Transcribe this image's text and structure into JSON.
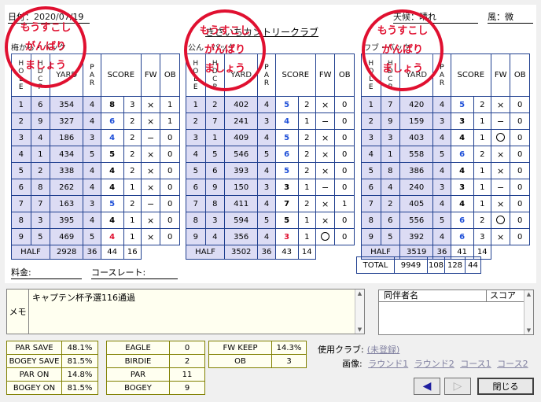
{
  "header": {
    "date": "日付：2020/07/19",
    "weather": "天候：晴れ",
    "wind": "風：微",
    "course_name": "きさいちカントリークラブ",
    "partial_labels": [
      "梅から・バック",
      "公ん・バック",
      "ワブ・バック"
    ]
  },
  "stamp_lines": [
    "もうすこし",
    "がんばり",
    "ましょう"
  ],
  "columns": {
    "hole": "HOLE",
    "hdcp": "HDCP",
    "yard": "YARD",
    "par": "PAR",
    "score": "SCORE",
    "fw": "FW",
    "ob": "OB"
  },
  "half_label": "HALF",
  "total_label": "TOTAL",
  "marks": {
    "hit": "○",
    "miss": "×",
    "none": "−"
  },
  "rounds": [
    {
      "rows": [
        {
          "hole": "1",
          "hdcp": "6",
          "yard": "354",
          "par": "4",
          "score": "8",
          "putt": "3",
          "fw": "miss",
          "ob": "1"
        },
        {
          "hole": "2",
          "hdcp": "9",
          "yard": "327",
          "par": "4",
          "score": "6",
          "putt": "2",
          "fw": "miss",
          "ob": "1"
        },
        {
          "hole": "3",
          "hdcp": "4",
          "yard": "186",
          "par": "3",
          "score": "4",
          "putt": "2",
          "fw": "none",
          "ob": "0"
        },
        {
          "hole": "4",
          "hdcp": "1",
          "yard": "434",
          "par": "5",
          "score": "5",
          "putt": "2",
          "fw": "miss",
          "ob": "0"
        },
        {
          "hole": "5",
          "hdcp": "2",
          "yard": "338",
          "par": "4",
          "score": "4",
          "putt": "2",
          "fw": "miss",
          "ob": "0"
        },
        {
          "hole": "6",
          "hdcp": "8",
          "yard": "262",
          "par": "4",
          "score": "4",
          "putt": "1",
          "fw": "miss",
          "ob": "0"
        },
        {
          "hole": "7",
          "hdcp": "7",
          "yard": "163",
          "par": "3",
          "score": "5",
          "putt": "2",
          "fw": "none",
          "ob": "0"
        },
        {
          "hole": "8",
          "hdcp": "3",
          "yard": "395",
          "par": "4",
          "score": "4",
          "putt": "1",
          "fw": "miss",
          "ob": "0"
        },
        {
          "hole": "9",
          "hdcp": "5",
          "yard": "469",
          "par": "5",
          "score": "4",
          "putt": "1",
          "fw": "miss",
          "ob": "0"
        }
      ],
      "score_colors": [
        "#000000",
        "#1e4fd8",
        "#1e4fd8",
        "#000000",
        "#000000",
        "#000000",
        "#1e4fd8",
        "#000000",
        "#e01030"
      ],
      "half": {
        "yard": "2928",
        "par": "36",
        "score": "44",
        "putt": "16"
      }
    },
    {
      "rows": [
        {
          "hole": "1",
          "hdcp": "2",
          "yard": "402",
          "par": "4",
          "score": "5",
          "putt": "2",
          "fw": "miss",
          "ob": "0"
        },
        {
          "hole": "2",
          "hdcp": "7",
          "yard": "241",
          "par": "3",
          "score": "4",
          "putt": "1",
          "fw": "none",
          "ob": "0"
        },
        {
          "hole": "3",
          "hdcp": "1",
          "yard": "409",
          "par": "4",
          "score": "5",
          "putt": "2",
          "fw": "miss",
          "ob": "0"
        },
        {
          "hole": "4",
          "hdcp": "5",
          "yard": "546",
          "par": "5",
          "score": "6",
          "putt": "2",
          "fw": "miss",
          "ob": "0"
        },
        {
          "hole": "5",
          "hdcp": "6",
          "yard": "393",
          "par": "4",
          "score": "5",
          "putt": "2",
          "fw": "miss",
          "ob": "0"
        },
        {
          "hole": "6",
          "hdcp": "9",
          "yard": "150",
          "par": "3",
          "score": "3",
          "putt": "1",
          "fw": "none",
          "ob": "0"
        },
        {
          "hole": "7",
          "hdcp": "8",
          "yard": "411",
          "par": "4",
          "score": "7",
          "putt": "2",
          "fw": "miss",
          "ob": "1"
        },
        {
          "hole": "8",
          "hdcp": "3",
          "yard": "594",
          "par": "5",
          "score": "5",
          "putt": "1",
          "fw": "miss",
          "ob": "0"
        },
        {
          "hole": "9",
          "hdcp": "4",
          "yard": "356",
          "par": "4",
          "score": "3",
          "putt": "1",
          "fw": "hit",
          "ob": "0"
        }
      ],
      "score_colors": [
        "#1e4fd8",
        "#1e4fd8",
        "#1e4fd8",
        "#1e4fd8",
        "#1e4fd8",
        "#000000",
        "#000000",
        "#000000",
        "#e01030"
      ],
      "half": {
        "yard": "3502",
        "par": "36",
        "score": "43",
        "putt": "14"
      }
    },
    {
      "rows": [
        {
          "hole": "1",
          "hdcp": "7",
          "yard": "420",
          "par": "4",
          "score": "5",
          "putt": "2",
          "fw": "miss",
          "ob": "0"
        },
        {
          "hole": "2",
          "hdcp": "9",
          "yard": "159",
          "par": "3",
          "score": "3",
          "putt": "1",
          "fw": "none",
          "ob": "0"
        },
        {
          "hole": "3",
          "hdcp": "3",
          "yard": "403",
          "par": "4",
          "score": "4",
          "putt": "1",
          "fw": "hit",
          "ob": "0"
        },
        {
          "hole": "4",
          "hdcp": "1",
          "yard": "558",
          "par": "5",
          "score": "6",
          "putt": "2",
          "fw": "miss",
          "ob": "0"
        },
        {
          "hole": "5",
          "hdcp": "8",
          "yard": "386",
          "par": "4",
          "score": "4",
          "putt": "1",
          "fw": "miss",
          "ob": "0"
        },
        {
          "hole": "6",
          "hdcp": "4",
          "yard": "240",
          "par": "3",
          "score": "3",
          "putt": "1",
          "fw": "none",
          "ob": "0"
        },
        {
          "hole": "7",
          "hdcp": "2",
          "yard": "405",
          "par": "4",
          "score": "4",
          "putt": "1",
          "fw": "miss",
          "ob": "0"
        },
        {
          "hole": "8",
          "hdcp": "6",
          "yard": "556",
          "par": "5",
          "score": "6",
          "putt": "2",
          "fw": "hit",
          "ob": "0"
        },
        {
          "hole": "9",
          "hdcp": "5",
          "yard": "392",
          "par": "4",
          "score": "6",
          "putt": "3",
          "fw": "miss",
          "ob": "0"
        }
      ],
      "score_colors": [
        "#1e4fd8",
        "#000000",
        "#000000",
        "#1e4fd8",
        "#000000",
        "#000000",
        "#000000",
        "#1e4fd8",
        "#1e4fd8"
      ],
      "half": {
        "yard": "3519",
        "par": "36",
        "score": "41",
        "putt": "14"
      }
    }
  ],
  "total": {
    "label": "TOTAL",
    "yard": "9949",
    "par": "108",
    "score": "128",
    "putt": "44"
  },
  "fee_label": "料金:",
  "course_rate_label": "コースレート:",
  "memo": {
    "label": "メモ",
    "text": "キャプテン杯予選116通過"
  },
  "companions": {
    "col_name": "同伴者名",
    "col_score": "スコア"
  },
  "stats": {
    "left": [
      {
        "label": "PAR SAVE",
        "value": "48.1%"
      },
      {
        "label": "BOGEY SAVE",
        "value": "81.5%"
      },
      {
        "label": "PAR ON",
        "value": "14.8%"
      },
      {
        "label": "BOGEY ON",
        "value": "81.5%"
      }
    ],
    "middle": [
      {
        "label": "EAGLE",
        "value": "0"
      },
      {
        "label": "BIRDIE",
        "value": "2"
      },
      {
        "label": "PAR",
        "value": "11"
      },
      {
        "label": "BOGEY",
        "value": "9"
      }
    ],
    "right": [
      {
        "label": "FW KEEP",
        "value": "14.3%"
      },
      {
        "label": "OB",
        "value": "3"
      }
    ]
  },
  "links": {
    "clubs_label": "使用クラブ:",
    "clubs_link": "(未登録)",
    "images_label": "画像:",
    "round1": "ラウンド1",
    "round2": "ラウンド2",
    "course1": "コース1",
    "course2": "コース2"
  },
  "buttons": {
    "back": "◀",
    "forward": "▷",
    "close": "閉じる"
  }
}
